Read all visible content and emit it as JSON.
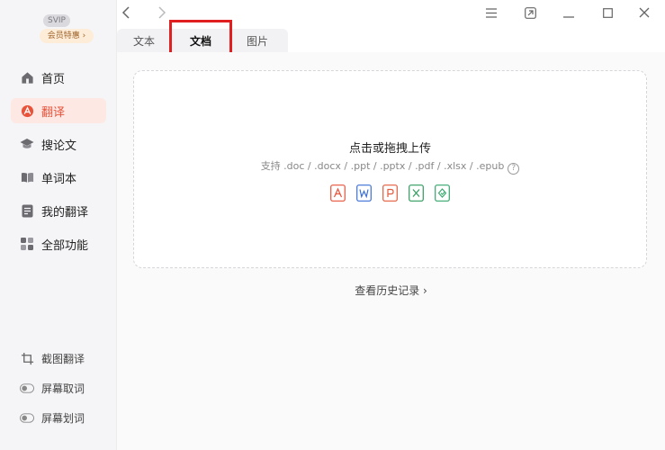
{
  "sidebar": {
    "svip_badge": "SVIP",
    "vip_promo": "会员特惠 ›",
    "nav": [
      {
        "label": "首页",
        "icon": "home-icon"
      },
      {
        "label": "翻译",
        "icon": "translate-icon"
      },
      {
        "label": "搜论文",
        "icon": "graduation-cap-icon"
      },
      {
        "label": "单词本",
        "icon": "book-icon"
      },
      {
        "label": "我的翻译",
        "icon": "document-icon"
      },
      {
        "label": "全部功能",
        "icon": "grid-icon"
      }
    ],
    "active_nav": 1,
    "tools": [
      {
        "label": "截图翻译",
        "icon": "crop-icon"
      },
      {
        "label": "屏幕取词",
        "icon": "toggle-icon"
      },
      {
        "label": "屏幕划词",
        "icon": "toggle-icon"
      }
    ]
  },
  "tabs": [
    {
      "label": "文本"
    },
    {
      "label": "文档"
    },
    {
      "label": "图片"
    }
  ],
  "active_tab": 1,
  "upload": {
    "title": "点击或拖拽上传",
    "supported": "支持 .doc / .docx / .ppt / .pptx / .pdf / .xlsx / .epub",
    "help": "?"
  },
  "file_types": [
    "pdf",
    "word",
    "ppt",
    "excel",
    "epub"
  ],
  "history_link": "查看历史记录 ›",
  "colors": {
    "accent": "#e8533a",
    "highlight": "#e02020",
    "pdf": "#e8533a",
    "word": "#3b6fd6",
    "ppt": "#e25b3c",
    "excel": "#2e9b5c",
    "epub": "#33a66b"
  }
}
